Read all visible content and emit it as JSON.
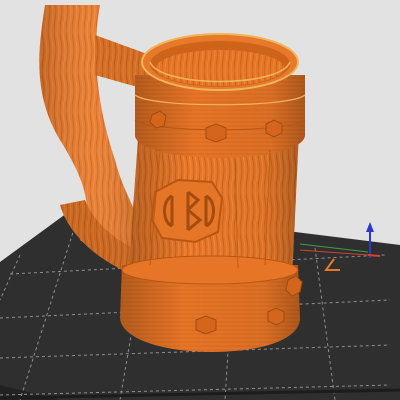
{
  "viewport": {
    "background_color": "#e2e2e2",
    "model_color": "#e8782a",
    "model_highlight_color": "#f0b45a",
    "bed_color": "#2f2f2f",
    "bed_grid_color": "#8f8f8f"
  },
  "model": {
    "type": "tankard-with-horn-handle",
    "emblem_icon": "d20-dice-emblem-icon"
  },
  "axes_gizmo": {
    "x_color": "#d8402a",
    "y_color": "#3aa04a",
    "z_color": "#2a3ad0"
  },
  "origin_marker": {
    "icon": "bed-origin-marker-icon",
    "color": "#e8782a"
  }
}
